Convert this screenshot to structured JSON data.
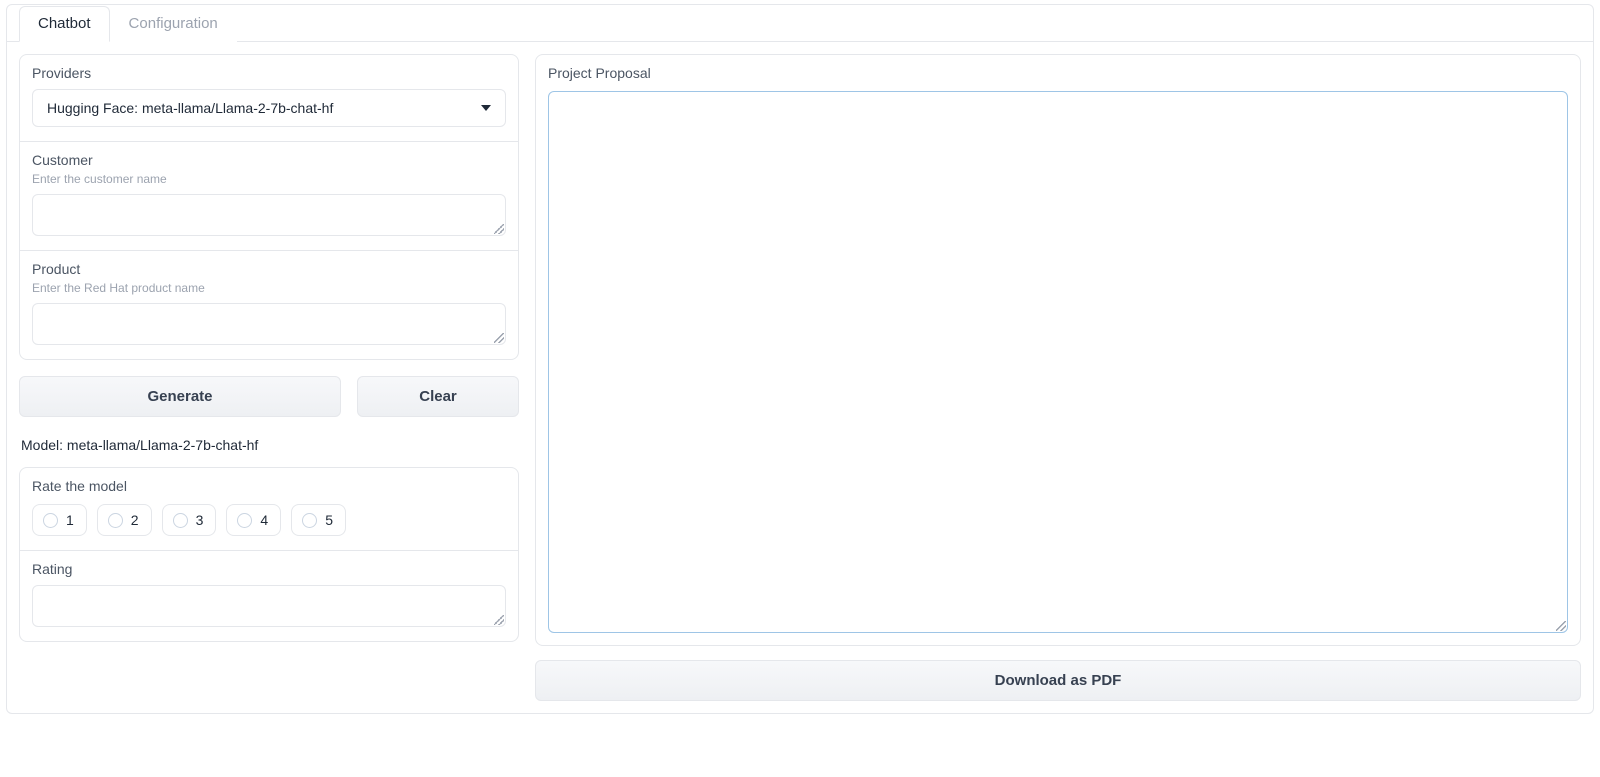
{
  "tabs": {
    "chatbot": "Chatbot",
    "configuration": "Configuration"
  },
  "providers": {
    "label": "Providers",
    "selected": "Hugging Face: meta-llama/Llama-2-7b-chat-hf"
  },
  "customer": {
    "label": "Customer",
    "help": "Enter the customer name",
    "value": ""
  },
  "product": {
    "label": "Product",
    "help": "Enter the Red Hat product name",
    "value": ""
  },
  "buttons": {
    "generate": "Generate",
    "clear": "Clear",
    "download": "Download as PDF"
  },
  "model_line": "Model: meta-llama/Llama-2-7b-chat-hf",
  "rate": {
    "label": "Rate the model",
    "options": [
      "1",
      "2",
      "3",
      "4",
      "5"
    ]
  },
  "rating": {
    "label": "Rating",
    "value": ""
  },
  "proposal": {
    "label": "Project Proposal",
    "value": ""
  }
}
